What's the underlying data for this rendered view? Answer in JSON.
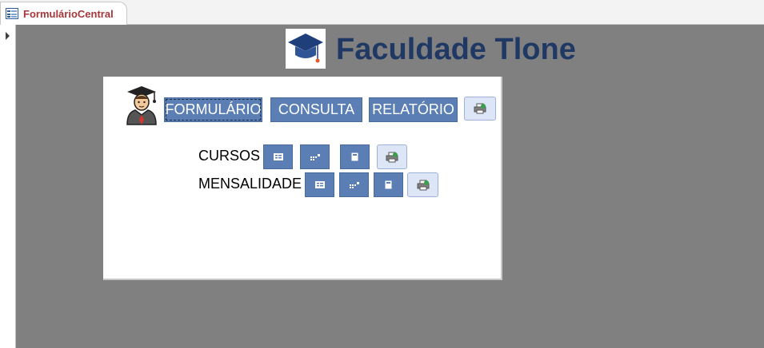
{
  "tab": {
    "label": "FormulárioCentral"
  },
  "header": {
    "title": "Faculdade Tlone"
  },
  "nav": {
    "formulario": "FORMULÁRIO",
    "consulta": "CONSULTA",
    "relatorio": "RELATÓRIO"
  },
  "rows": [
    {
      "label": "CURSOS"
    },
    {
      "label": "MENSALIDADE"
    }
  ],
  "colors": {
    "background": "#808080",
    "accent": "#5b7fb4",
    "title": "#1f3864",
    "tab_label": "#a4373a"
  },
  "icons": [
    "form-icon",
    "graduation-cap-icon",
    "student-avatar-icon",
    "form-view-icon",
    "datasheet-icon",
    "report-icon",
    "printer-icon",
    "record-selector-arrow-icon"
  ]
}
